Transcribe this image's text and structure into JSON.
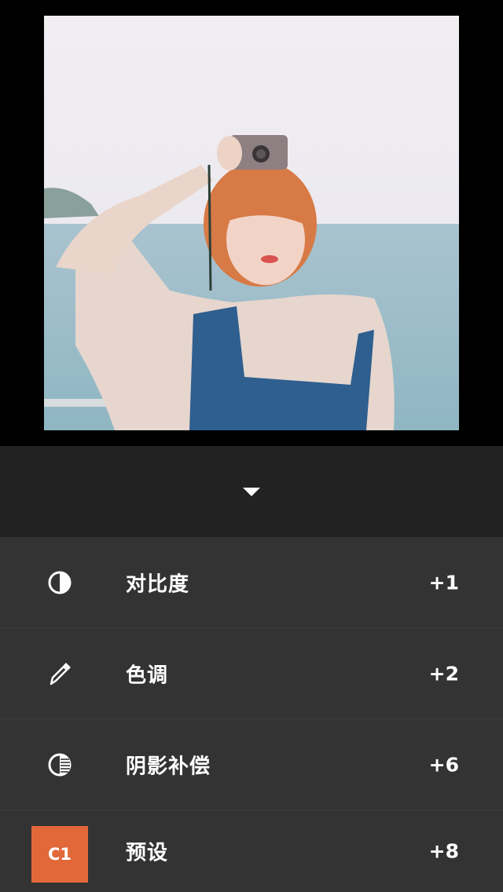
{
  "photo": {
    "subject": "photo-preview"
  },
  "collapse": {
    "icon": "triangle-down-icon"
  },
  "adjustments": [
    {
      "icon": "contrast-icon",
      "label": "对比度",
      "value": "+1"
    },
    {
      "icon": "pen-icon",
      "label": "色调",
      "value": "+2"
    },
    {
      "icon": "shadow-icon",
      "label": "阴影补偿",
      "value": "+6"
    },
    {
      "icon": "preset-badge",
      "badge": "C1",
      "label": "预设",
      "value": "+8"
    }
  ],
  "colors": {
    "accent": "#e2683a",
    "panel": "#333333",
    "collapse_bar": "#222222",
    "background": "#000000"
  }
}
